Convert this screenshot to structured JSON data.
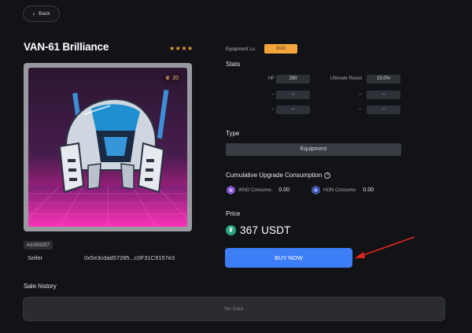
{
  "nav": {
    "back_label": "Back"
  },
  "item": {
    "name": "VAN-61 Brilliance",
    "stars": "★★★★",
    "badge_value": "20",
    "token_id": "#1000207",
    "seller_label": "Seller",
    "seller_address": "0x5e3cdad57285...c0F31C9157e3"
  },
  "equipment_level": {
    "label": "Equipment Lv.",
    "value": "0/10"
  },
  "stats": {
    "title": "Stats",
    "rows": [
      {
        "left_label": "HP",
        "left_value": "260",
        "right_label": "Ultimate Resist",
        "right_value": "15.0%"
      },
      {
        "left_label": "--",
        "left_value": "--",
        "right_label": "--",
        "right_value": "--"
      },
      {
        "left_label": "--",
        "left_value": "--",
        "right_label": "--",
        "right_value": "--"
      }
    ]
  },
  "type": {
    "title": "Type",
    "value": "Equipment"
  },
  "upgrade": {
    "title": "Cumulative Upgrade Consumption",
    "items": [
      {
        "label": "WND Consume:",
        "value": "0.00"
      },
      {
        "label": "HON Consume:",
        "value": "0.00"
      }
    ]
  },
  "price": {
    "title": "Price",
    "value": "367 USDT",
    "currency_icon": "tether-icon"
  },
  "buy_button_label": "BUY NOW",
  "sale_history": {
    "title": "Sale history",
    "empty_text": "No Data"
  },
  "colors": {
    "background": "#121316",
    "accent": "#3d7ef7",
    "level_badge": "#f4a43c",
    "stars": "#f2a33a",
    "annotation_arrow": "#e0261f"
  }
}
